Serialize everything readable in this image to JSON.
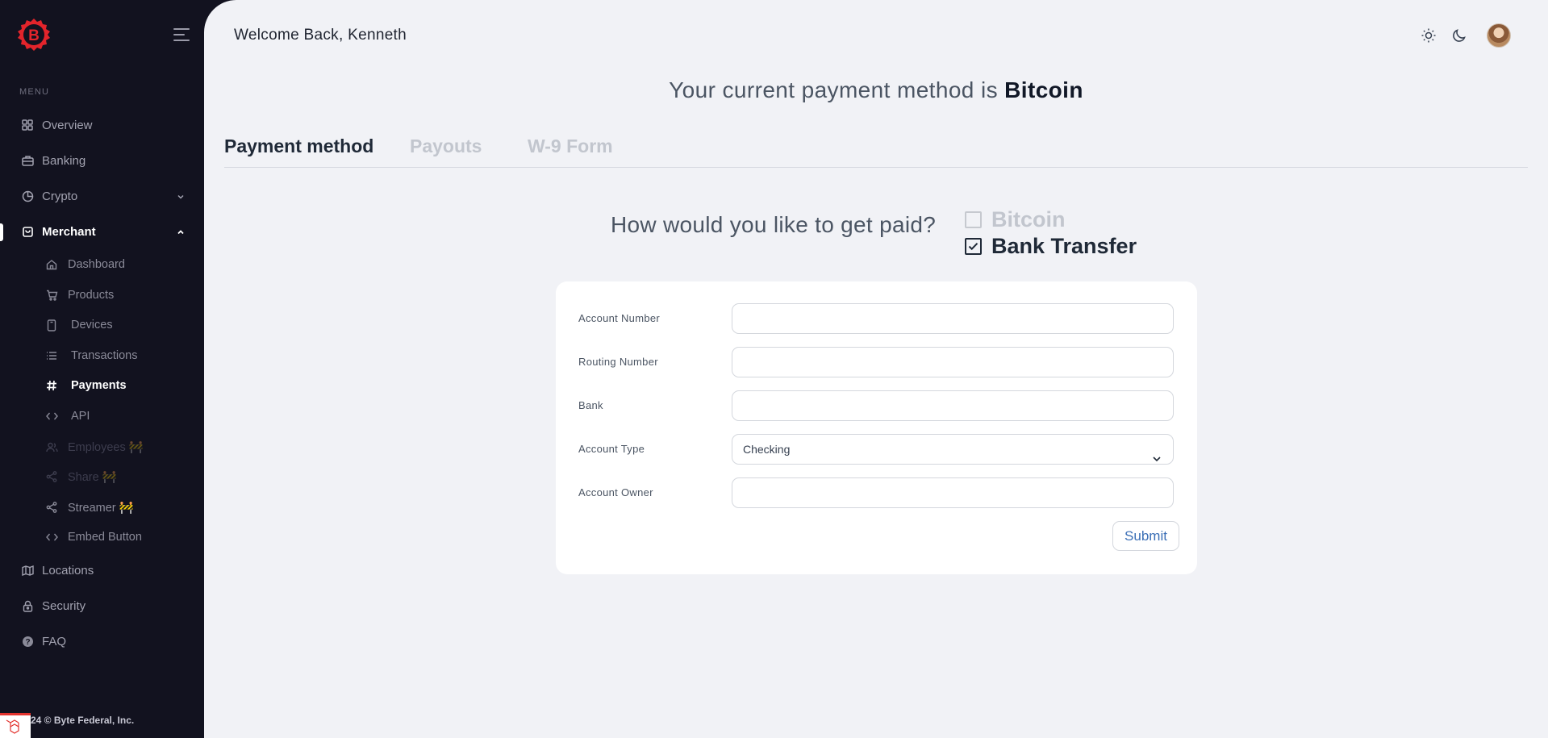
{
  "sidebar": {
    "menu_label": "MENU",
    "items": [
      {
        "label": "Overview",
        "icon": "grid-icon"
      },
      {
        "label": "Banking",
        "icon": "briefcase-icon"
      },
      {
        "label": "Crypto",
        "icon": "pie-chart-icon"
      },
      {
        "label": "Merchant",
        "icon": "shopping-bag-icon"
      },
      {
        "label": "Locations",
        "icon": "map-icon"
      },
      {
        "label": "Security",
        "icon": "lock-icon"
      },
      {
        "label": "FAQ",
        "icon": "help-circle-icon"
      }
    ],
    "merchant_sub": [
      {
        "label": "Dashboard",
        "icon": "home-icon"
      },
      {
        "label": "Products",
        "icon": "cart-icon"
      },
      {
        "label": "Devices",
        "icon": "device-icon"
      },
      {
        "label": "Transactions",
        "icon": "list-icon"
      },
      {
        "label": "Payments",
        "icon": "hash-icon"
      },
      {
        "label": "API",
        "icon": "code-icon"
      },
      {
        "label": "Employees",
        "icon": "users-icon",
        "badge": "🚧"
      },
      {
        "label": "Share",
        "icon": "share-icon",
        "badge": "🚧"
      },
      {
        "label": "Streamer",
        "icon": "share-icon",
        "badge": "🚧"
      },
      {
        "label": "Embed Button",
        "icon": "code-icon"
      }
    ],
    "footer": "24 © Byte Federal, Inc."
  },
  "header": {
    "welcome": "Welcome Back, Kenneth"
  },
  "current_method": {
    "prefix": "Your current payment method is",
    "method": "Bitcoin"
  },
  "tabs": [
    "Payment method",
    "Payouts",
    "W-9 Form"
  ],
  "question": "How would you like to get paid?",
  "options": [
    {
      "label": "Bitcoin",
      "checked": false
    },
    {
      "label": "Bank Transfer",
      "checked": true
    }
  ],
  "form": {
    "fields": [
      {
        "label": "Account Number",
        "value": ""
      },
      {
        "label": "Routing Number",
        "value": ""
      },
      {
        "label": "Bank",
        "value": ""
      },
      {
        "label": "Account Type",
        "value": "Checking"
      },
      {
        "label": "Account Owner",
        "value": ""
      }
    ],
    "submit_label": "Submit"
  },
  "colors": {
    "sidebar_bg": "#12121f",
    "main_bg": "#f1f2f6",
    "brand_red": "#e3242b",
    "submit_text": "#3b6fb6"
  }
}
